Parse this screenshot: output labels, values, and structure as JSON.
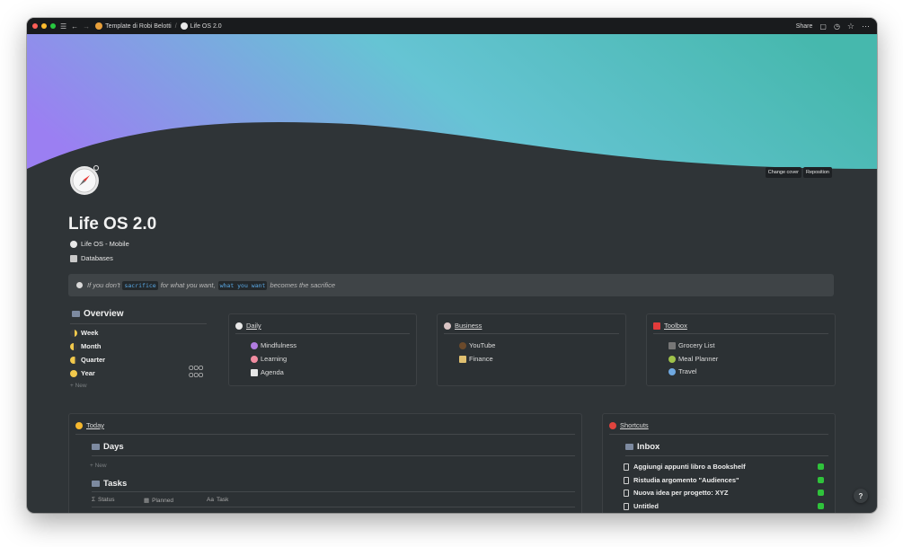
{
  "topbar": {
    "breadcrumb": [
      "Template di Robi Belotti",
      "Life OS 2.0"
    ],
    "share_label": "Share",
    "right_icons": [
      "comment-icon",
      "clock-icon",
      "star-icon",
      "more-icon"
    ]
  },
  "cover": {
    "change_label": "Change cover",
    "reposition_label": "Reposition",
    "gradient": [
      "#9d7ff0",
      "#67c7d2",
      "#48b9b0"
    ]
  },
  "page": {
    "title": "Life OS 2.0",
    "links": [
      "Life OS - Mobile",
      "Databases"
    ]
  },
  "callout": {
    "pre": "If you don't",
    "code1": "sacrifice",
    "mid": "for what you want,",
    "code2": "what you want",
    "post": "becomes the sacrifice"
  },
  "overview": {
    "title": "Overview",
    "items": [
      "Week",
      "Month",
      "Quarter",
      "Year"
    ],
    "new_label": "+ New",
    "dots": "OOO\nOOO"
  },
  "cards": {
    "daily": {
      "title": "Daily",
      "items": [
        "Mindfulness",
        "Learning",
        "Agenda"
      ]
    },
    "business": {
      "title": "Business",
      "items": [
        "YouTube",
        "Finance"
      ]
    },
    "toolbox": {
      "title": "Toolbox",
      "items": [
        "Grocery List",
        "Meal Planner",
        "Travel"
      ]
    }
  },
  "today": {
    "title": "Today",
    "days_label": "Days",
    "new_label": "+ New",
    "tasks_label": "Tasks",
    "columns": [
      "Status",
      "Planned",
      "Task"
    ]
  },
  "shortcuts": {
    "title": "Shortcuts",
    "inbox_label": "Inbox",
    "rows": [
      "Aggiungi appunti libro a Bookshelf",
      "Ristudia argomento \"Audiences\"",
      "Nuova idea per progetto: XYZ",
      "Untitled"
    ]
  },
  "help_label": "?"
}
